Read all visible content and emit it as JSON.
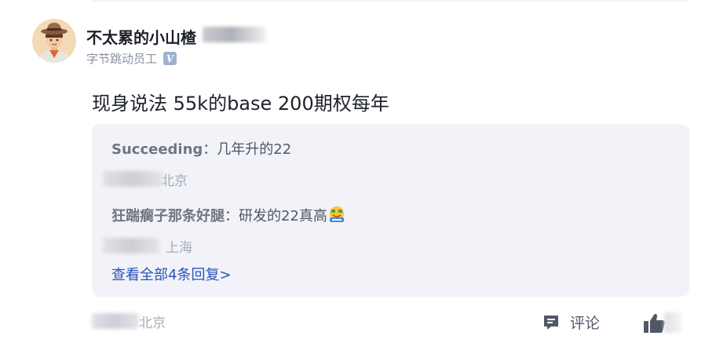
{
  "post": {
    "author": {
      "name": "不太累的小山楂",
      "company": "字节跳动员工",
      "verified_mark": "V"
    },
    "content": "现身说法 55k的base 200期权每年",
    "location": "北京",
    "actions": {
      "comment_label": "评论"
    }
  },
  "replies": {
    "items": [
      {
        "author": "Succeeding",
        "separator": "：",
        "content": "几年升的22",
        "location": "北京"
      },
      {
        "author": "狂踹瘸子那条好腿",
        "separator": "：",
        "content": "研发的22真高",
        "emoji": "money-face-emoji",
        "location": "上海"
      }
    ],
    "view_all_label": "查看全部4条回复>"
  },
  "colors": {
    "link": "#2a52be",
    "reply_background": "#f2f3f8",
    "muted_text": "#a7acb6",
    "verified_badge": "#9fb1cf"
  }
}
